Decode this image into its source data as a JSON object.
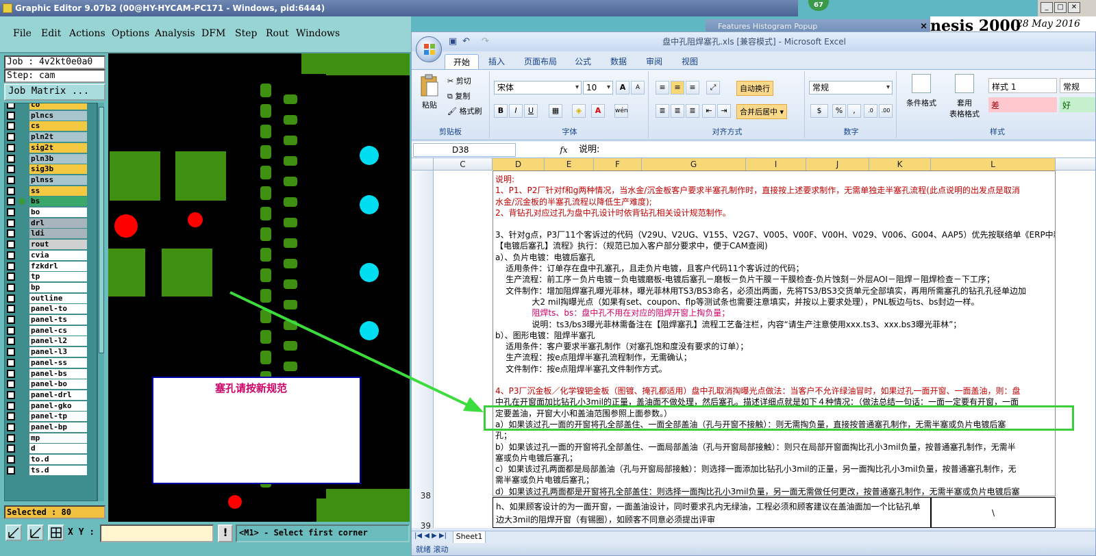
{
  "cam": {
    "title": "Graphic Editor 9.07b2 (00@HY-HYCAM-PC171 - Windows, pid:6444)",
    "menus": [
      {
        "label": "File"
      },
      {
        "label": "Edit"
      },
      {
        "label": "Actions"
      },
      {
        "label": "Options"
      },
      {
        "label": "Analysis"
      },
      {
        "label": "DFM"
      },
      {
        "label": "Step"
      },
      {
        "label": "Rout"
      },
      {
        "label": "Windows"
      }
    ],
    "job": "Job : 4v2kt0e0a0",
    "step": "Step: cam",
    "job_matrix": "Job Matrix ...",
    "layers": [
      {
        "name": "co",
        "color": "#f5c842"
      },
      {
        "name": "plncs",
        "color": "#a8c4cc"
      },
      {
        "name": "cs",
        "color": "#f5c842"
      },
      {
        "name": "pln2t",
        "color": "#a8c4cc"
      },
      {
        "name": "sig2t",
        "color": "#f5c842"
      },
      {
        "name": "pln3b",
        "color": "#a8c4cc"
      },
      {
        "name": "sig3b",
        "color": "#f5c842"
      },
      {
        "name": "plnss",
        "color": "#a8c4cc"
      },
      {
        "name": "ss",
        "color": "#f5c842"
      },
      {
        "name": "bs",
        "color": "#3aa86a"
      },
      {
        "name": "bo",
        "color": "#ffffff"
      },
      {
        "name": "drl",
        "color": "#a8b4bc"
      },
      {
        "name": "ldi",
        "color": "#a8b4bc"
      },
      {
        "name": "rout",
        "color": "#d0d0d0"
      },
      {
        "name": "cvia",
        "color": "#ffffff"
      },
      {
        "name": "fzkdrl",
        "color": "#ffffff"
      },
      {
        "name": "tp",
        "color": "#ffffff"
      },
      {
        "name": "bp",
        "color": "#ffffff"
      },
      {
        "name": "outline",
        "color": "#ffffff"
      },
      {
        "name": "panel-to",
        "color": "#ffffff"
      },
      {
        "name": "panel-ts",
        "color": "#ffffff"
      },
      {
        "name": "panel-cs",
        "color": "#ffffff"
      },
      {
        "name": "panel-l2",
        "color": "#ffffff"
      },
      {
        "name": "panel-l3",
        "color": "#ffffff"
      },
      {
        "name": "panel-ss",
        "color": "#ffffff"
      },
      {
        "name": "panel-bs",
        "color": "#ffffff"
      },
      {
        "name": "panel-bo",
        "color": "#ffffff"
      },
      {
        "name": "panel-drl",
        "color": "#ffffff"
      },
      {
        "name": "panel-gko",
        "color": "#ffffff"
      },
      {
        "name": "panel-tp",
        "color": "#ffffff"
      },
      {
        "name": "panel-bp",
        "color": "#ffffff"
      },
      {
        "name": "mp",
        "color": "#ffffff"
      },
      {
        "name": "d",
        "color": "#ffffff"
      },
      {
        "name": "to.d",
        "color": "#ffffff"
      },
      {
        "name": "ts.d",
        "color": "#ffffff"
      }
    ],
    "selected": "Selected : 80",
    "xy_label": "X Y :",
    "status_msg": "<M1> - Select first corner",
    "warn": "!",
    "canvas_note": "塞孔请按新规范"
  },
  "background": {
    "popup_title": "Features Histogram Popup",
    "genesis": "nesis 2000",
    "date": "28 May 2016",
    "badge": "67"
  },
  "excel": {
    "title": "盘中孔阻焊塞孔.xls  [兼容模式] - Microsoft Excel",
    "tabs": [
      {
        "label": "开始"
      },
      {
        "label": "插入"
      },
      {
        "label": "页面布局"
      },
      {
        "label": "公式"
      },
      {
        "label": "数据"
      },
      {
        "label": "审阅"
      },
      {
        "label": "视图"
      }
    ],
    "ribbon": {
      "paste": "粘贴",
      "cut": "剪切",
      "copy": "复制",
      "format_painter": "格式刷",
      "clipboard": "剪贴板",
      "font_name": "宋体",
      "font_size": "10",
      "font_group": "字体",
      "wrap_text": "自动换行",
      "merge_center": "合并后居中",
      "alignment_group": "对齐方式",
      "number_format": "常规",
      "number_group": "数字",
      "cond_format": "条件格式",
      "table_format": "套用",
      "table_format2": "表格格式",
      "style1": "样式 1",
      "style_normal": "常规",
      "bad": "差",
      "good": "好",
      "styles_group": "样式"
    },
    "name_box": "D38",
    "fx": "fx",
    "formula": "说明:",
    "columns": [
      "C",
      "D",
      "E",
      "F",
      "G",
      "I",
      "J",
      "K",
      "L"
    ],
    "rows": [
      "38",
      "39"
    ],
    "cell_lines": [
      {
        "text": "说明:",
        "cls": "red"
      },
      {
        "text": "1、P1、P2厂针对f和g两种情况，当水金/沉金板客户要求半塞孔制作时，直接按上述要求制作，无需单独走半塞孔流程(此点说明的出发点是取消",
        "cls": "red"
      },
      {
        "text": "水金/沉金板的半塞孔流程以降低生产难度);",
        "cls": "red"
      },
      {
        "text": "2、背钻孔对应过孔为盘中孔设计时依背钻孔相关设计规范制作。",
        "cls": "red"
      },
      {
        "text": "",
        "cls": ""
      },
      {
        "text": "3、针对g点，P3厂11个客诉过的代码（V29U、V2UG、V155、V2G7、V005、V00F、V00H、V029、V006、G004、AAP5）优先按联络单《ERP中新增",
        "cls": ""
      },
      {
        "text": "【电镀后塞孔】流程》执行：（规范已加入客户部分要求中，便于CAM查阅)",
        "cls": ""
      },
      {
        "text": "a）、负片电镀：电镀后塞孔",
        "cls": ""
      },
      {
        "text": "    适用条件：订单存在盘中孔塞孔，且走负片电镀，且客户代码11个客诉过的代码；",
        "cls": ""
      },
      {
        "text": "    生产流程：前工序－负片电镀－负电镀磨板-电镀后塞孔－磨板－负片干膜－干膜检查-负片蚀刻－外层AOI－阻焊－阻焊检查－下工序；",
        "cls": ""
      },
      {
        "text": "    文件制作：增加阻焊塞孔曝光菲林，曝光菲林用TS3/BS3命名，必须出两面，先将TS3/BS3交货单元全部填实，再用所需塞孔的钻孔孔径单边加",
        "cls": ""
      },
      {
        "text": "              大2 mil掏曝光点（如果有set、coupon、flp等测试条也需要注意填实，并按以上要求处理），PNL板边与ts、bs封边一样。",
        "cls": ""
      },
      {
        "text": "              阻焊ts、bs：盘中孔不用在对应的阻焊开窗上掏负量；",
        "cls": "mag"
      },
      {
        "text": "              说明：ts3/bs3曝光菲林需备注在【阻焊塞孔】流程工艺备注栏，内容“请生产注意使用xxx.ts3、xxx.bs3曝光菲林”；",
        "cls": ""
      },
      {
        "text": "b）、图形电镀：阻焊半塞孔",
        "cls": ""
      },
      {
        "text": "    适用条件：客户要求半塞孔制作（对塞孔饱和度没有要求的订单）；",
        "cls": ""
      },
      {
        "text": "    生产流程：按e点阻焊半塞孔流程制作，无需确认；",
        "cls": ""
      },
      {
        "text": "    文件制作：按e点阻焊半塞孔文件制作方式。",
        "cls": ""
      },
      {
        "text": "",
        "cls": ""
      },
      {
        "text": "4、P3厂沉金板／化学镍钯金板（图镀、掩孔都适用）盘中孔取消掏曝光点做法：当客户不允许绿油冒时，如果过孔一面开窗、一面盖油，则：盘",
        "cls": "red"
      },
      {
        "text": "中孔在开窗面加比钻孔小3mil的正量，盖油面不做处理，然后塞孔。描述详细点就是如下４种情况：（做法总结一句话：一面一定要有开窗，一面",
        "cls": ""
      },
      {
        "text": "定要盖油，开窗大小和盖油范围参照上面参数。）",
        "cls": ""
      },
      {
        "text": "a）如果该过孔一面的开窗将孔全部盖住、一面全部盖油（孔与开窗不接触）：则无需掏负量，直接按普通塞孔制作，无需半塞或负片电镀后塞",
        "cls": ""
      },
      {
        "text": "孔；",
        "cls": ""
      },
      {
        "text": "b）如果该过孔一面的开窗将孔全部盖住、一面局部盖油（孔与开窗局部接触）：则只在局部开窗面掏比孔小3mil负量，按普通塞孔制作，无需半",
        "cls": ""
      },
      {
        "text": "塞或负片电镀后塞孔；",
        "cls": ""
      },
      {
        "text": "c）如果该过孔两面都是局部盖油（孔与开窗局部接触）：则选择一面添加比钻孔小3mil的正量，另一面掏比孔小3mil负量，按普通塞孔制作，无",
        "cls": ""
      },
      {
        "text": "需半塞或负片电镀后塞孔；",
        "cls": ""
      },
      {
        "text": "d）如果该过孔两面都是开窗将孔全部盖住：则选择一面掏比孔小3mil负量，另一面无需做任何更改，按普通塞孔制作，无需半塞或负片电镀后塞",
        "cls": ""
      },
      {
        "text": "孔；",
        "cls": ""
      }
    ],
    "row39_text": "h、如果顾客设计的为一面开窗，一面盖油设计，同时要求孔内无绿油，工程必须和顾客建议在盖油面加一个比钻孔单边大3mil的阻焊开窗（有锡圈），如顾客不同意必须提出评审",
    "row39_l": "\\",
    "sheet": "Sheet1",
    "status": "就绪  滚动"
  },
  "colors": {
    "pcb_green": "#3f8f10",
    "pad_cyan": "#00dcf0",
    "pad_red": "#ff0000",
    "arrow_green": "#3cdc3c"
  }
}
